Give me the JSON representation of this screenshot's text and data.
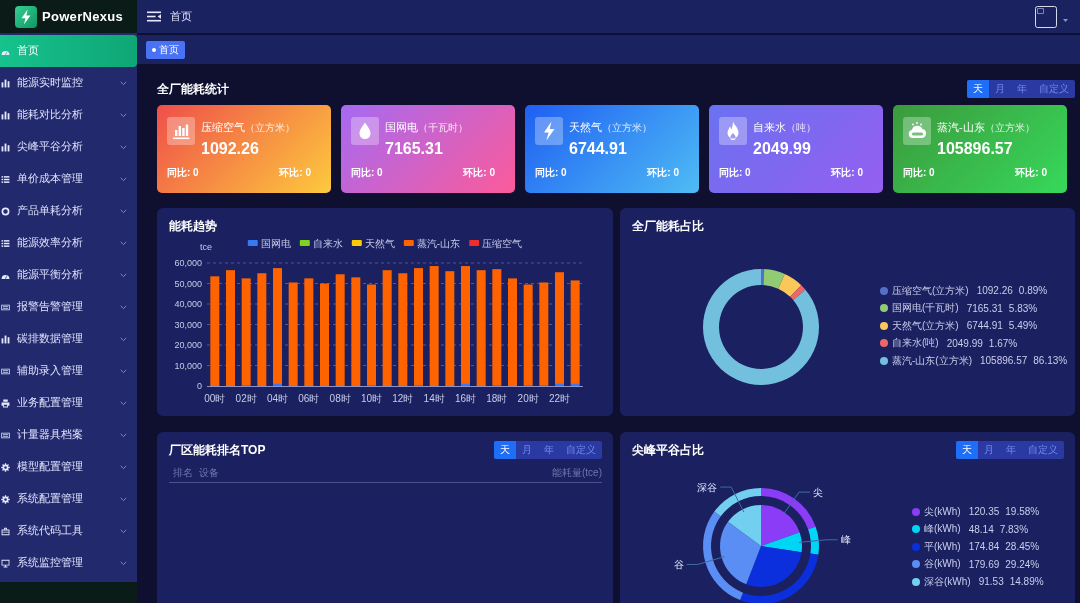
{
  "sidebar": {
    "brand": "PowerNexus",
    "items": [
      {
        "label": "首页",
        "selected": true
      },
      {
        "label": "能源实时监控",
        "selected": false,
        "expanded": false
      },
      {
        "label": "能耗对比分析",
        "selected": false,
        "expanded": false
      },
      {
        "label": "尖峰平谷分析",
        "selected": false,
        "expanded": false
      },
      {
        "label": "单价成本管理",
        "selected": false,
        "expanded": false
      },
      {
        "label": "产品单耗分析",
        "selected": false,
        "expanded": false
      },
      {
        "label": "能源效率分析",
        "selected": false,
        "expanded": false
      },
      {
        "label": "能源平衡分析",
        "selected": false,
        "expanded": false
      },
      {
        "label": "报警告警管理",
        "selected": false,
        "expanded": false
      },
      {
        "label": "碳排数据管理",
        "selected": false,
        "expanded": false
      },
      {
        "label": "辅助录入管理",
        "selected": false,
        "expanded": false
      },
      {
        "label": "业务配置管理",
        "selected": false,
        "expanded": false
      },
      {
        "label": "计量器具档案",
        "selected": false,
        "expanded": false
      },
      {
        "label": "模型配置管理",
        "selected": false,
        "expanded": false
      },
      {
        "label": "系统配置管理",
        "selected": false,
        "expanded": false
      },
      {
        "label": "系统代码工具",
        "selected": false,
        "expanded": false
      },
      {
        "label": "系统监控管理",
        "selected": false,
        "expanded": false
      }
    ]
  },
  "header": {
    "breadcrumb": "首页"
  },
  "tags": [
    {
      "label": "首页",
      "selected": true
    }
  ],
  "overview": {
    "title": "全厂能耗统计",
    "period_tabs": [
      {
        "label": "天",
        "selected": true
      },
      {
        "label": "月",
        "selected": false
      },
      {
        "label": "年",
        "selected": false
      },
      {
        "label": "自定义",
        "selected": false
      }
    ],
    "cards": [
      {
        "title": "压缩空气",
        "unit": "（立方米）",
        "value": "1092.26",
        "yoy": "同比: 0",
        "mom": "环比: 0"
      },
      {
        "title": "国网电",
        "unit": "（千瓦时）",
        "value": "7165.31",
        "yoy": "同比: 0",
        "mom": "环比: 0"
      },
      {
        "title": "天然气",
        "unit": "（立方米）",
        "value": "6744.91",
        "yoy": "同比: 0",
        "mom": "环比: 0"
      },
      {
        "title": "自来水",
        "unit": "（吨）",
        "value": "2049.99",
        "yoy": "同比: 0",
        "mom": "环比: 0"
      },
      {
        "title": "蒸汽-山东",
        "unit": "（立方米）",
        "value": "105896.57",
        "yoy": "同比: 0",
        "mom": "环比: 0"
      }
    ]
  },
  "trend_panel": {
    "title": "能耗趋势",
    "chart_data": {
      "type": "bar",
      "stacked": true,
      "legend": "top",
      "grid": true,
      "ylabel": "tce",
      "x": [
        0,
        1,
        2,
        3,
        4,
        5,
        6,
        7,
        8,
        9,
        10,
        11,
        12,
        13,
        14,
        15,
        16,
        17,
        18,
        19,
        20,
        21,
        22,
        23
      ],
      "xlim": [
        -0.5,
        23.5
      ],
      "xticks": [
        {
          "value": 0,
          "label": "00时"
        },
        {
          "value": 2,
          "label": "02时"
        },
        {
          "value": 4,
          "label": "04时"
        },
        {
          "value": 6,
          "label": "06时"
        },
        {
          "value": 8,
          "label": "08时"
        },
        {
          "value": 10,
          "label": "10时"
        },
        {
          "value": 12,
          "label": "12时"
        },
        {
          "value": 14,
          "label": "14时"
        },
        {
          "value": 16,
          "label": "16时"
        },
        {
          "value": 18,
          "label": "18时"
        },
        {
          "value": 20,
          "label": "20时"
        },
        {
          "value": 22,
          "label": "22时"
        }
      ],
      "ylim": [
        0,
        60000
      ],
      "yticks": [
        {
          "value": 0,
          "label": "0"
        },
        {
          "value": 10000,
          "label": "10,000"
        },
        {
          "value": 20000,
          "label": "20,000"
        },
        {
          "value": 30000,
          "label": "30,000"
        },
        {
          "value": 40000,
          "label": "40,000"
        },
        {
          "value": 50000,
          "label": "50,000"
        },
        {
          "value": 60000,
          "label": "60,000"
        }
      ],
      "series": [
        {
          "name": "国网电",
          "color": "#3a78f2",
          "values": [
            0,
            0,
            500,
            0,
            1000,
            0,
            0,
            0,
            0,
            0,
            500,
            0,
            0,
            500,
            0,
            0,
            1000,
            0,
            500,
            0,
            500,
            500,
            1000,
            1000
          ]
        },
        {
          "name": "自来水",
          "color": "#7ed321",
          "values": [
            0,
            0,
            0,
            0,
            0,
            0,
            0,
            0,
            0,
            0,
            0,
            0,
            0,
            0,
            0,
            0,
            0,
            0,
            0,
            0,
            0,
            0,
            0,
            0
          ]
        },
        {
          "name": "天然气",
          "color": "#fccb05",
          "values": [
            0,
            0,
            0,
            0,
            0,
            0,
            0,
            0,
            0,
            0,
            0,
            0,
            0,
            0,
            0,
            0,
            0,
            0,
            0,
            0,
            0,
            0,
            0,
            0
          ]
        },
        {
          "name": "蒸汽-山东",
          "color": "#ff6300",
          "values": [
            53500,
            56500,
            52000,
            55000,
            56500,
            50500,
            52500,
            50000,
            54500,
            53000,
            49000,
            56500,
            55000,
            57000,
            58500,
            56000,
            57500,
            56500,
            56500,
            52500,
            49000,
            50000,
            54500,
            50500
          ]
        },
        {
          "name": "压缩空气",
          "color": "#ee2e2e",
          "values": [
            0,
            0,
            0,
            0,
            0,
            0,
            0,
            0,
            0,
            0,
            0,
            0,
            0,
            0,
            0,
            0,
            0,
            0,
            0,
            0,
            0,
            0,
            0,
            0
          ]
        }
      ]
    }
  },
  "ratio_panel": {
    "title": "全厂能耗占比",
    "chart_data": {
      "type": "donut",
      "legend": "right",
      "categories": [
        "压缩空气(立方米)",
        "国网电(千瓦时)",
        "天然气(立方米)",
        "自来水(吨)",
        "蒸汽-山东(立方米)"
      ],
      "values": [
        0.89,
        5.83,
        5.49,
        1.67,
        86.13
      ],
      "colors": [
        "#5470c6",
        "#91cc75",
        "#fac858",
        "#ee6666",
        "#73c0de"
      ]
    },
    "legend_items": [
      {
        "value": "1092.26",
        "percent": "0.89%"
      },
      {
        "value": "7165.31",
        "percent": "5.83%"
      },
      {
        "value": "6744.91",
        "percent": "5.49%"
      },
      {
        "value": "2049.99",
        "percent": "1.67%"
      },
      {
        "value": "105896.57",
        "percent": "86.13%"
      }
    ]
  },
  "ranking_panel": {
    "title": "厂区能耗排名TOP",
    "period_tabs": [
      {
        "label": "天",
        "selected": true
      },
      {
        "label": "月",
        "selected": false
      },
      {
        "label": "年",
        "selected": false
      },
      {
        "label": "自定义",
        "selected": false
      }
    ],
    "table": {
      "columns": [
        "排名",
        "设备",
        "能耗量(tce)"
      ]
    }
  },
  "peak_valley_panel": {
    "title": "尖峰平谷占比",
    "period_tabs": [
      {
        "label": "天",
        "selected": true
      },
      {
        "label": "月",
        "selected": false
      },
      {
        "label": "年",
        "selected": false
      },
      {
        "label": "自定义",
        "selected": false
      }
    ],
    "chart_data": {
      "type": "donut",
      "legend": "right",
      "categories": [
        "尖(kWh)",
        "峰(kWh)",
        "平(kWh)",
        "谷(kWh)",
        "深谷(kWh)"
      ],
      "colors": [
        "#8b3cf7",
        "#00d5f5",
        "#0b2fdc",
        "#5b8ef5",
        "#72cff0"
      ],
      "series": [
        {
          "values": [
            19.58,
            7.83,
            28.45,
            29.24,
            14.89
          ]
        },
        {
          "values": [
            19.58,
            7.83,
            28.45,
            29.24,
            14.89
          ]
        }
      ],
      "value_labels": [
        "尖",
        "峰",
        null,
        "谷",
        "深谷"
      ]
    },
    "legend_items": [
      {
        "value": "120.35",
        "percent": "19.58%"
      },
      {
        "value": "48.14",
        "percent": "7.83%"
      },
      {
        "value": "174.84",
        "percent": "28.45%"
      },
      {
        "value": "179.69",
        "percent": "29.24%"
      },
      {
        "value": "91.53",
        "percent": "14.89%"
      }
    ]
  }
}
